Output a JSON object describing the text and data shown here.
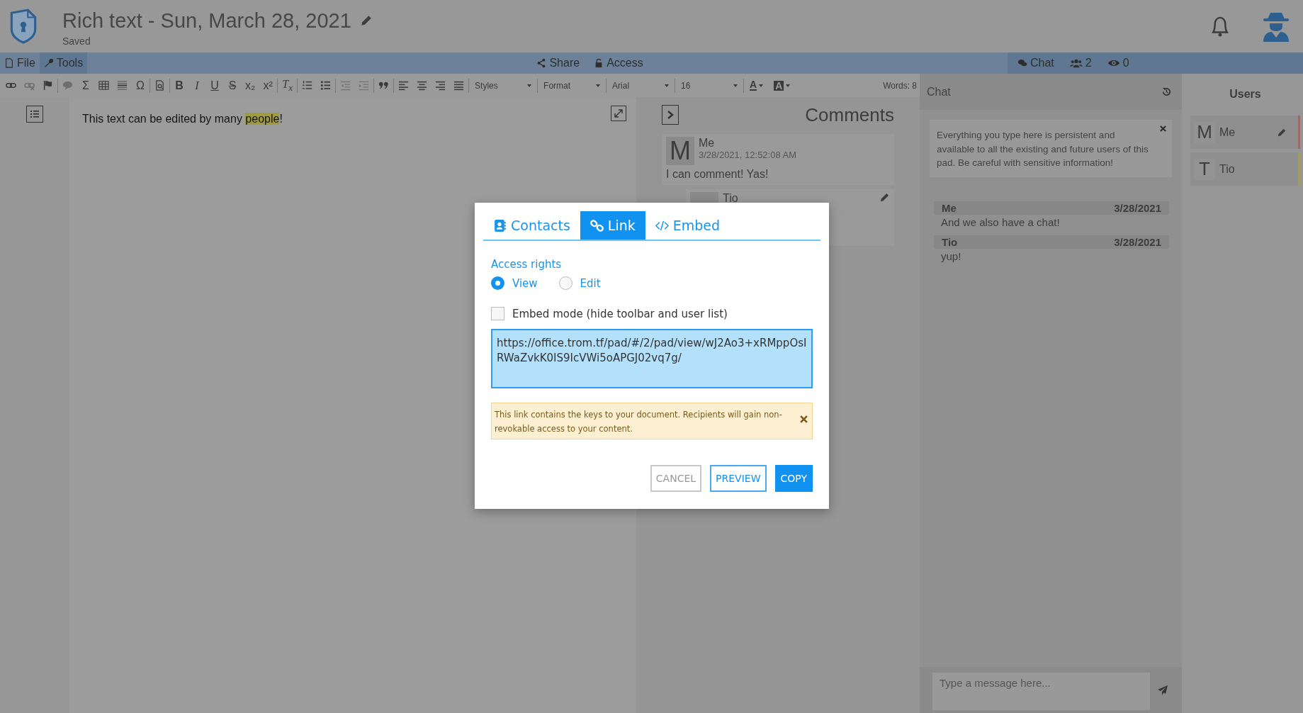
{
  "header": {
    "title": "Rich text - Sun, March 28, 2021",
    "status": "Saved"
  },
  "menubar": {
    "left": [
      {
        "kind": "file",
        "label": "File",
        "selected": false
      },
      {
        "kind": "tools",
        "label": "Tools",
        "selected": true
      }
    ],
    "center": [
      {
        "kind": "share",
        "label": "Share"
      },
      {
        "kind": "access",
        "label": "Access"
      }
    ],
    "right": [
      {
        "kind": "chat",
        "label": "Chat"
      },
      {
        "kind": "users",
        "label": "2"
      },
      {
        "kind": "viewers",
        "label": "0"
      }
    ]
  },
  "toolbar": {
    "groups": [
      [
        {
          "kind": "link",
          "disabled": false
        },
        {
          "kind": "unlink",
          "disabled": true
        },
        {
          "kind": "flag",
          "disabled": false
        }
      ],
      [
        {
          "kind": "comment",
          "disabled": true
        },
        {
          "kind": "symbol",
          "text": "Σ",
          "disabled": false
        },
        {
          "kind": "table",
          "disabled": false
        },
        {
          "kind": "hr",
          "disabled": false
        },
        {
          "kind": "symbol",
          "text": "Ω",
          "disabled": false
        }
      ],
      [
        {
          "kind": "preview",
          "disabled": false
        }
      ],
      [
        {
          "kind": "bold",
          "text": "B",
          "disabled": false
        },
        {
          "kind": "italic",
          "text": "I",
          "disabled": false
        },
        {
          "kind": "underline",
          "text": "U",
          "disabled": false
        },
        {
          "kind": "strike",
          "text": "S",
          "disabled": false
        },
        {
          "kind": "symbol",
          "text": "x₂",
          "disabled": false
        },
        {
          "kind": "symbol",
          "text": "x²",
          "disabled": false
        }
      ],
      [
        {
          "kind": "italic",
          "text": "T$_{x}$",
          "disabled": false
        }
      ],
      [
        {
          "kind": "ol",
          "disabled": false
        },
        {
          "kind": "ul",
          "disabled": false
        }
      ],
      [
        {
          "kind": "outdent",
          "disabled": true
        },
        {
          "kind": "indent",
          "disabled": true
        }
      ],
      [
        {
          "kind": "quote",
          "disabled": false
        }
      ],
      [
        {
          "kind": "align-left",
          "disabled": false
        },
        {
          "kind": "align-center",
          "disabled": false
        },
        {
          "kind": "align-right",
          "disabled": false
        },
        {
          "kind": "justify",
          "disabled": false
        }
      ],
      [
        {
          "kind": "select",
          "value": "Styles",
          "disabled": false
        }
      ],
      [
        {
          "kind": "select",
          "value": "Format",
          "disabled": false
        }
      ],
      [
        {
          "kind": "select",
          "value": "Arial",
          "disabled": false
        }
      ],
      [
        {
          "kind": "select",
          "value": "16",
          "disabled": false
        }
      ],
      [
        {
          "kind": "text-color",
          "text": "A",
          "disabled": false
        },
        {
          "kind": "bg-color",
          "text": "A",
          "disabled": false
        }
      ]
    ],
    "words": "Words: 8"
  },
  "document": {
    "segments": [
      {
        "text": "This text can be edited by many ",
        "highlight": false
      },
      {
        "text": "people",
        "highlight": true
      },
      {
        "text": "!",
        "highlight": false
      }
    ]
  },
  "comments": {
    "title": "Comments",
    "items": [
      {
        "avatar": "M",
        "author": "Me",
        "date": "3/28/2021, 12:52:08 AM",
        "text": "I can comment! Yas!",
        "reply": false
      },
      {
        "author": "Tio",
        "reply": true
      }
    ]
  },
  "modal": {
    "tabs": [
      {
        "kind": "contacts",
        "label": "Contacts",
        "selected": false
      },
      {
        "kind": "link",
        "label": "Link",
        "selected": true
      },
      {
        "kind": "embed",
        "label": "Embed",
        "selected": false
      }
    ],
    "access_label": "Access rights",
    "radios": [
      {
        "label": "View",
        "selected": true
      },
      {
        "label": "Edit",
        "selected": false
      }
    ],
    "checkbox": {
      "label": "Embed mode (hide toolbar and user list)",
      "checked": false
    },
    "url": "https://office.trom.tf/pad/#/2/pad/view/wJ2Ao3+xRMppOsIRWaZvkK0IS9IcVWi5oAPGJ02vq7g/",
    "warning": "This link contains the keys to your document. Recipients will gain non-revokable access to your content.",
    "buttons": [
      {
        "kind": "cancel",
        "label": "CANCEL"
      },
      {
        "kind": "preview",
        "label": "PREVIEW"
      },
      {
        "kind": "copy",
        "label": "COPY"
      }
    ]
  },
  "chat": {
    "title": "Chat",
    "notice": "Everything you type here is persistent and available to all the existing and future users of this pad. Be careful with sensitive information!",
    "messages": [
      {
        "author": "Me",
        "date": "3/28/2021",
        "text": "And we also have a chat!"
      },
      {
        "author": "Tio",
        "date": "3/28/2021",
        "text": "yup!"
      }
    ],
    "placeholder": "Type a message here..."
  },
  "users": {
    "title": "Users",
    "items": [
      {
        "avatar": "M",
        "name": "Me",
        "editing": true,
        "color": "#9c6b66"
      },
      {
        "avatar": "T",
        "name": "Tio",
        "editing": false,
        "color": "#a09c5c"
      }
    ]
  }
}
